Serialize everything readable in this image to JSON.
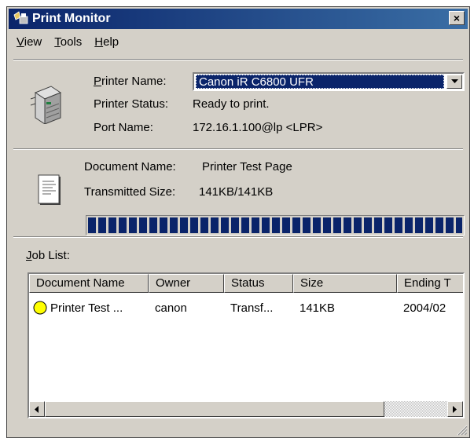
{
  "window": {
    "title": "Print Monitor",
    "close_label": "×"
  },
  "menu": {
    "items": [
      {
        "key": "V",
        "rest": "iew"
      },
      {
        "key": "T",
        "rest": "ools"
      },
      {
        "key": "H",
        "rest": "elp"
      }
    ]
  },
  "printer": {
    "name_label_key": "P",
    "name_label_rest": "rinter Name:",
    "name_value": "Canon iR C6800 UFR",
    "status_label": "Printer Status:",
    "status_value": "Ready to print.",
    "port_label": "Port Name:",
    "port_value": "172.16.1.100@lp <LPR>"
  },
  "document": {
    "name_label": "Document Name:",
    "name_value": "Printer Test Page",
    "size_label": "Transmitted Size:",
    "size_value": "141KB/141KB",
    "progress_percent": 100
  },
  "job_list": {
    "label_key": "J",
    "label_rest": "ob List:",
    "columns": [
      "Document Name",
      "Owner",
      "Status",
      "Size",
      "Ending T"
    ],
    "rows": [
      {
        "document": "Printer Test ...",
        "owner": "canon",
        "status": "Transf...",
        "size": "141KB",
        "ending": "2004/02"
      }
    ]
  },
  "colors": {
    "titlebar": "#0a246a",
    "selection": "#0a246a",
    "face": "#d4d0c8",
    "job_status_dot": "#ffff00"
  }
}
